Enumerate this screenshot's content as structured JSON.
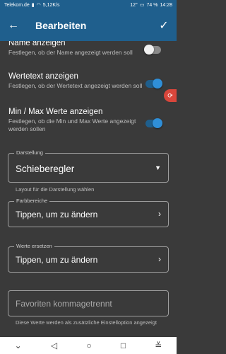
{
  "status": {
    "carrier": "Telekom.de",
    "network_speed": "5,12K/s",
    "temperature": "12°",
    "battery": "74 %",
    "time": "14:28"
  },
  "app_bar": {
    "title": "Bearbeiten"
  },
  "prefs": [
    {
      "label": "Name anzeigen",
      "desc": "Festlegen, ob der Name angezeigt werden soll",
      "enabled": false
    },
    {
      "label": "Wertetext anzeigen",
      "desc": "Festlegen, ob der Wertetext angezeigt werden soll",
      "enabled": true
    },
    {
      "label": "Min / Max Werte anzeigen",
      "desc": "Festlegen, ob die Min und Max Werte angezeigt werden sollen",
      "enabled": true
    }
  ],
  "darstellung": {
    "legend": "Darstellung",
    "value": "Schieberegler",
    "helper": "Layout für die Darstellung wählen"
  },
  "farbbereiche": {
    "legend": "Farbbereiche",
    "value": "Tippen, um zu ändern"
  },
  "werte_ersetzen": {
    "legend": "Werte ersetzen",
    "value": "Tippen, um zu ändern"
  },
  "favoriten": {
    "placeholder": "Favoriten kommagetrennt",
    "helper": "Diese Werte werden als zusätzliche Einstelloption angezeigt"
  }
}
